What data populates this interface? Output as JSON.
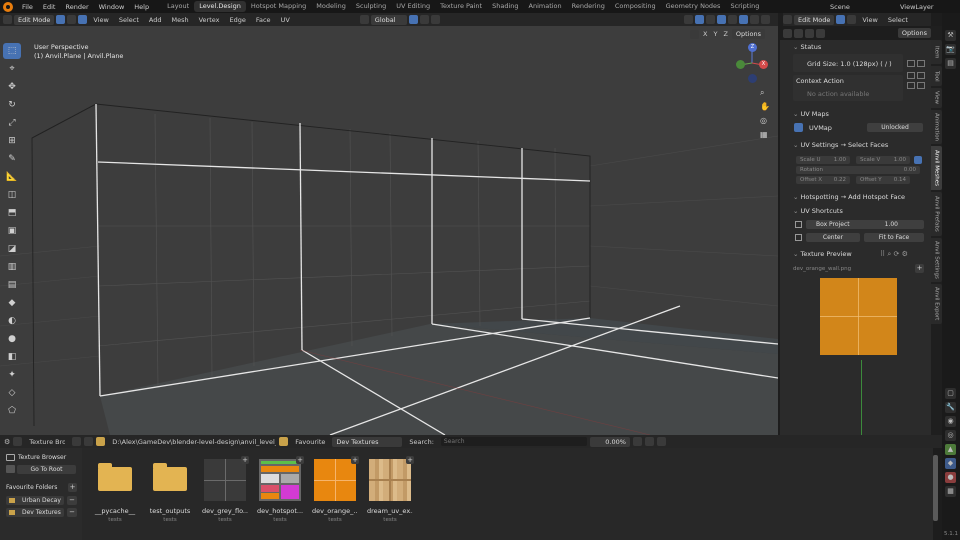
{
  "menubar": {
    "menus": [
      "File",
      "Edit",
      "Render",
      "Window",
      "Help"
    ],
    "workspaces": [
      "Layout",
      "Level.Design",
      "Hotspot Mapping",
      "Modeling",
      "Sculpting",
      "UV Editing",
      "Texture Paint",
      "Shading",
      "Animation",
      "Rendering",
      "Compositing",
      "Geometry Nodes",
      "Scripting"
    ],
    "active_workspace": "Level.Design",
    "scene_name": "Scene",
    "view_layer": "ViewLayer"
  },
  "viewport_header": {
    "mode": "Edit Mode",
    "menus": [
      "View",
      "Select",
      "Add",
      "Mesh",
      "Vertex",
      "Edge",
      "Face",
      "UV"
    ],
    "transform_orientation": "Global",
    "axes": [
      "X",
      "Y",
      "Z"
    ],
    "options_label": "Options"
  },
  "viewport": {
    "perspective_label": "User Perspective",
    "object_label": "(1) Anvil.Plane | Anvil.Plane",
    "gizmo": {
      "x": "X",
      "y": "Y",
      "z": "Z"
    }
  },
  "right_header": {
    "mode": "Edit Mode",
    "menus": [
      "View",
      "Select"
    ],
    "options_label": "Options"
  },
  "panel": {
    "status_title": "Status",
    "grid_size": "Grid Size: 1.0  (128px)  ( / )",
    "context_title": "Context Action",
    "context_value": "No action available",
    "uvmaps_title": "UV Maps",
    "uvmap_name": "UVMap",
    "uvmap_lock": "Unlocked",
    "uvsettings_title": "UV Settings  → Select Faces",
    "scale_u_label": "Scale U",
    "scale_u": "1.00",
    "scale_v_label": "Scale V",
    "scale_v": "1.00",
    "rotation_label": "Rotation",
    "rotation": "0.00",
    "offset_x_label": "Offset X",
    "offset_x": "0.22",
    "offset_y_label": "Offset Y",
    "offset_y": "0.14",
    "hotspot_title": "Hotspotting  → Add Hotspot Face",
    "shortcuts_title": "UV Shortcuts",
    "box_project_label": "Box Project",
    "box_project_value": "1.00",
    "center_label": "Center",
    "fit_label": "Fit to Face",
    "preview_title": "Texture Preview",
    "preview_file": "dev_orange_wall.png"
  },
  "side_tabs": [
    "Item",
    "Tool",
    "View",
    "Animation",
    "Anvil Meshes",
    "Anvil Prefabs",
    "Anvil Settings",
    "Anvil Export"
  ],
  "active_side_tab": "Anvil Meshes",
  "file_browser": {
    "editor_label": "Texture Bro...",
    "path": "D:\\Alex\\GameDev\\blender-level-design\\anvil_level_design\\...",
    "favourite_label": "Favourite",
    "favourite_value": "Dev Textures",
    "search_label": "Search:",
    "search_placeholder": "Search",
    "zoom_value": "0.00%",
    "sidebar_title": "Texture Browser",
    "go_root": "Go To Root",
    "fav_folders_title": "Favourite Folders",
    "fav_folders": [
      "Urban Decay",
      "Dev Textures"
    ],
    "items": [
      {
        "name": "__pycache__",
        "sub": "tests",
        "type": "folder"
      },
      {
        "name": "test_outputs",
        "sub": "tests",
        "type": "folder"
      },
      {
        "name": "dev_grey_flo...",
        "sub": "tests",
        "type": "grey"
      },
      {
        "name": "dev_hotspot...",
        "sub": "tests",
        "type": "hotspot"
      },
      {
        "name": "dev_orange_...",
        "sub": "tests",
        "type": "orange"
      },
      {
        "name": "dream_uv_ex...",
        "sub": "tests",
        "type": "wood"
      }
    ]
  },
  "version": "5.1.1",
  "colors": {
    "accent": "#4772b3",
    "orange": "#e8870f",
    "folder": "#e3b452"
  }
}
